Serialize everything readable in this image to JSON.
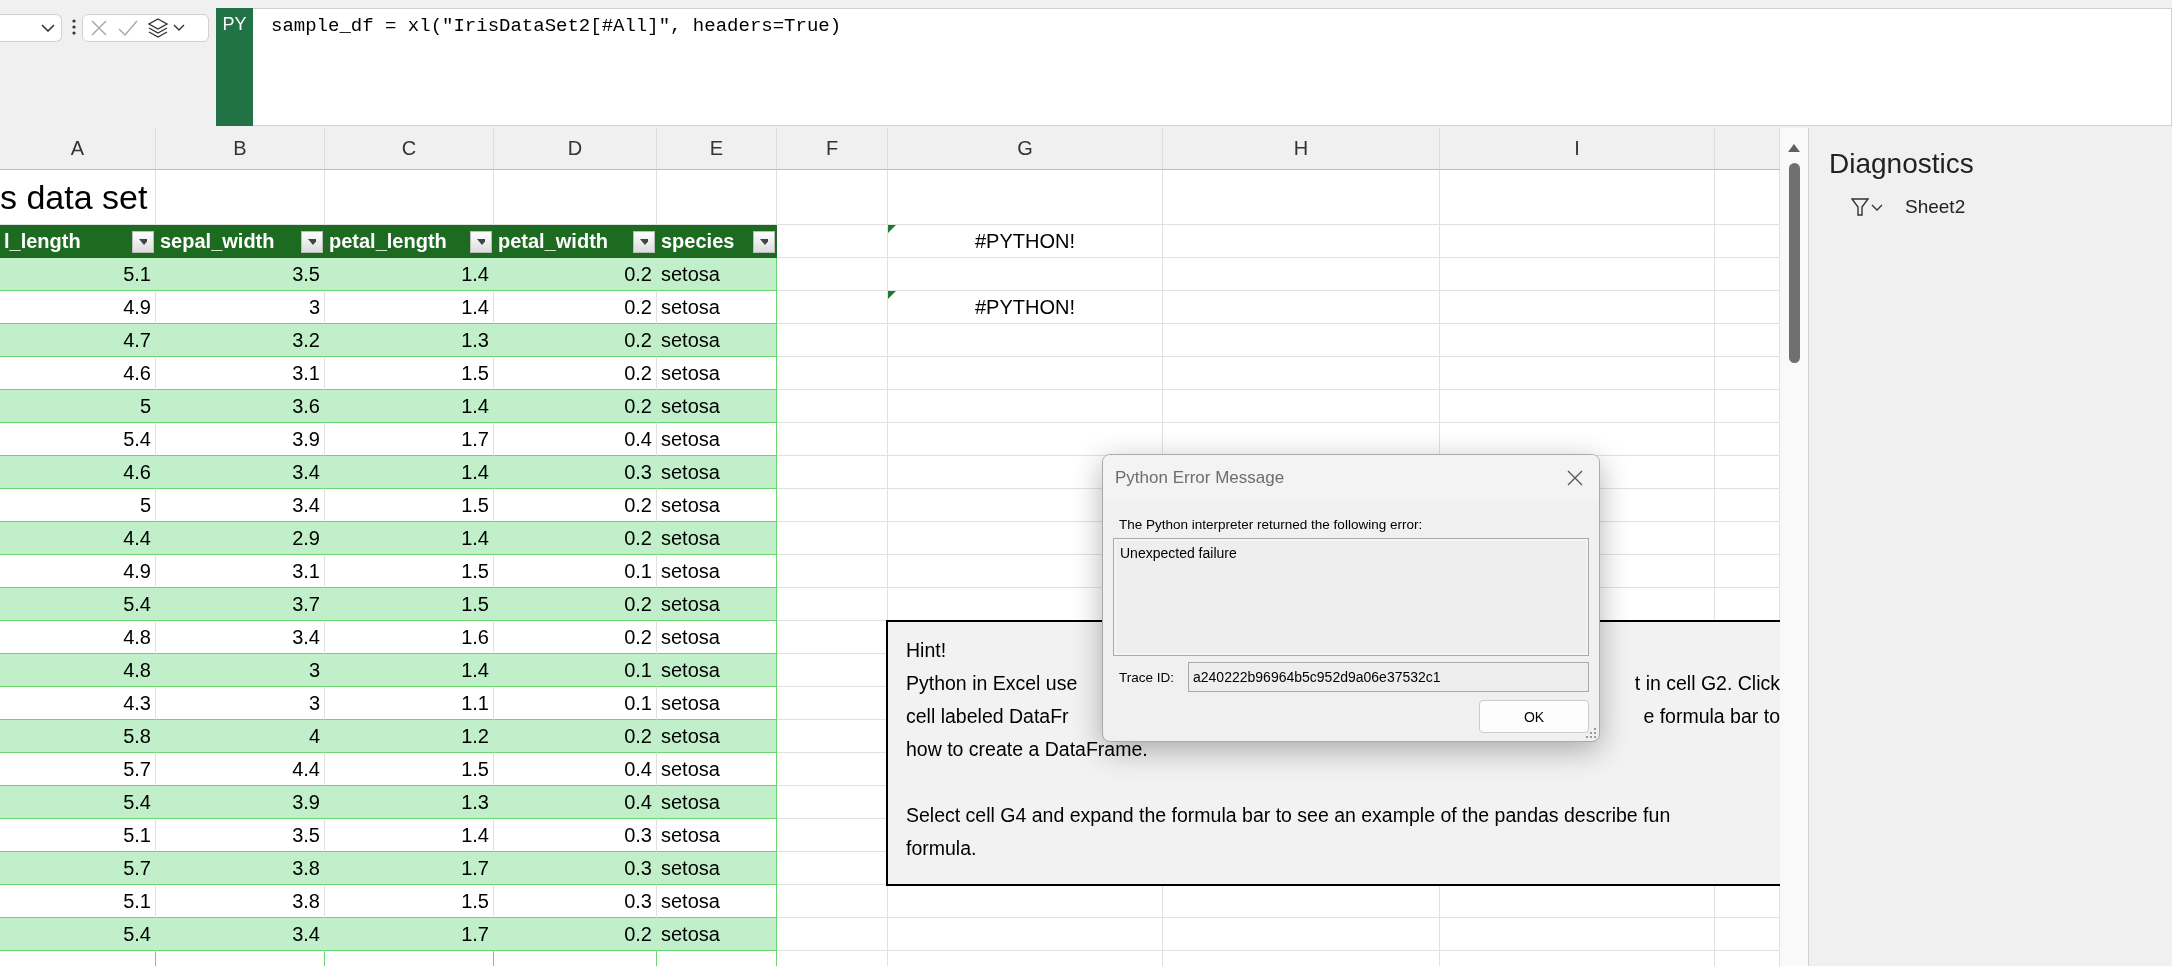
{
  "formula_bar": {
    "badge": "PY",
    "formula": "sample_df = xl(\"IrisDataSet2[#All]\", headers=True)"
  },
  "column_headers": [
    "A",
    "B",
    "C",
    "D",
    "E",
    "F",
    "G",
    "H",
    "I"
  ],
  "sheet": {
    "title": "s data set",
    "table": {
      "columns": [
        {
          "label": "l_length",
          "kind": "number"
        },
        {
          "label": "sepal_width",
          "kind": "number"
        },
        {
          "label": "petal_length",
          "kind": "number"
        },
        {
          "label": "petal_width",
          "kind": "number"
        },
        {
          "label": "species",
          "kind": "text"
        }
      ],
      "rows": [
        [
          "5.1",
          "3.5",
          "1.4",
          "0.2",
          "setosa"
        ],
        [
          "4.9",
          "3",
          "1.4",
          "0.2",
          "setosa"
        ],
        [
          "4.7",
          "3.2",
          "1.3",
          "0.2",
          "setosa"
        ],
        [
          "4.6",
          "3.1",
          "1.5",
          "0.2",
          "setosa"
        ],
        [
          "5",
          "3.6",
          "1.4",
          "0.2",
          "setosa"
        ],
        [
          "5.4",
          "3.9",
          "1.7",
          "0.4",
          "setosa"
        ],
        [
          "4.6",
          "3.4",
          "1.4",
          "0.3",
          "setosa"
        ],
        [
          "5",
          "3.4",
          "1.5",
          "0.2",
          "setosa"
        ],
        [
          "4.4",
          "2.9",
          "1.4",
          "0.2",
          "setosa"
        ],
        [
          "4.9",
          "3.1",
          "1.5",
          "0.1",
          "setosa"
        ],
        [
          "5.4",
          "3.7",
          "1.5",
          "0.2",
          "setosa"
        ],
        [
          "4.8",
          "3.4",
          "1.6",
          "0.2",
          "setosa"
        ],
        [
          "4.8",
          "3",
          "1.4",
          "0.1",
          "setosa"
        ],
        [
          "4.3",
          "3",
          "1.1",
          "0.1",
          "setosa"
        ],
        [
          "5.8",
          "4",
          "1.2",
          "0.2",
          "setosa"
        ],
        [
          "5.7",
          "4.4",
          "1.5",
          "0.4",
          "setosa"
        ],
        [
          "5.4",
          "3.9",
          "1.3",
          "0.4",
          "setosa"
        ],
        [
          "5.1",
          "3.5",
          "1.4",
          "0.3",
          "setosa"
        ],
        [
          "5.7",
          "3.8",
          "1.7",
          "0.3",
          "setosa"
        ],
        [
          "5.1",
          "3.8",
          "1.5",
          "0.3",
          "setosa"
        ],
        [
          "5.4",
          "3.4",
          "1.7",
          "0.2",
          "setosa"
        ]
      ]
    },
    "g_column": [
      "#PYTHON!",
      "#PYTHON!"
    ]
  },
  "hint": {
    "paragraphs": [
      [
        {
          "left": "Hint!"
        },
        {
          "left": "Python in Excel use",
          "right": "t in cell G2. Click"
        },
        {
          "left": "cell labeled DataFr",
          "right": "e formula bar to"
        },
        {
          "left": "how to create a DataFrame."
        }
      ],
      [
        {
          "left": "Select cell G4 and expand the formula bar to see an example of the pandas describe fun"
        },
        {
          "left": "formula."
        }
      ]
    ]
  },
  "dialog": {
    "title": "Python Error Message",
    "message": "The Python interpreter returned the following error:",
    "error": "Unexpected failure",
    "trace_label": "Trace ID:",
    "trace_id": "a240222b96964b5c952d9a06e37532c1",
    "button": "OK"
  },
  "diagnostics": {
    "title": "Diagnostics",
    "filter": "Sheet2"
  }
}
